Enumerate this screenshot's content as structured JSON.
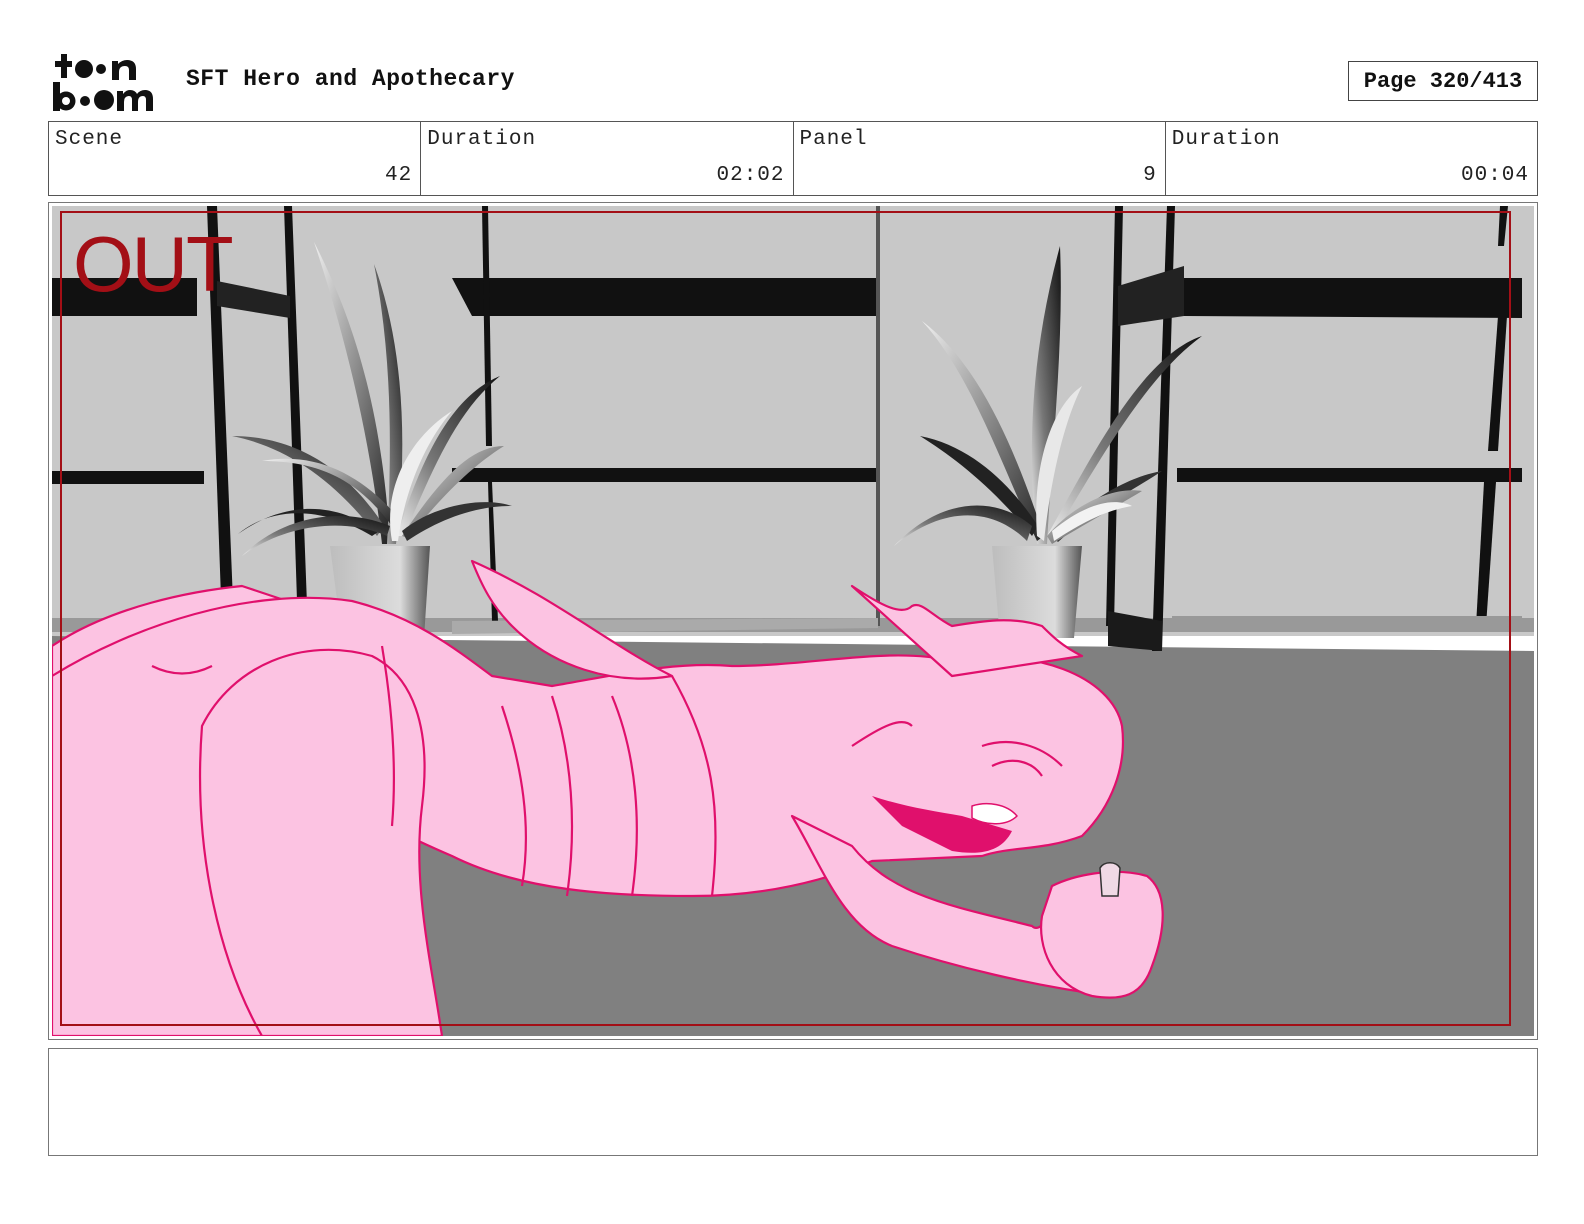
{
  "header": {
    "logo_text_top": "toon",
    "logo_text_bottom": "boom",
    "project_title": "SFT Hero and Apothecary",
    "page_label": "Page 320/413"
  },
  "info": {
    "scene_label": "Scene",
    "scene_value": "42",
    "scene_duration_label": "Duration",
    "scene_duration_value": "02:02",
    "panel_label": "Panel",
    "panel_value": "9",
    "panel_duration_label": "Duration",
    "panel_duration_value": "00:04"
  },
  "panel": {
    "overlay_text": "OUT",
    "overlay_color": "#a30f16",
    "sketch_fill": "#fcc3e2",
    "sketch_line": "#e0106c",
    "floor_color": "#808080",
    "wall_color": "#c8c8c8"
  },
  "notes": {
    "text": ""
  }
}
